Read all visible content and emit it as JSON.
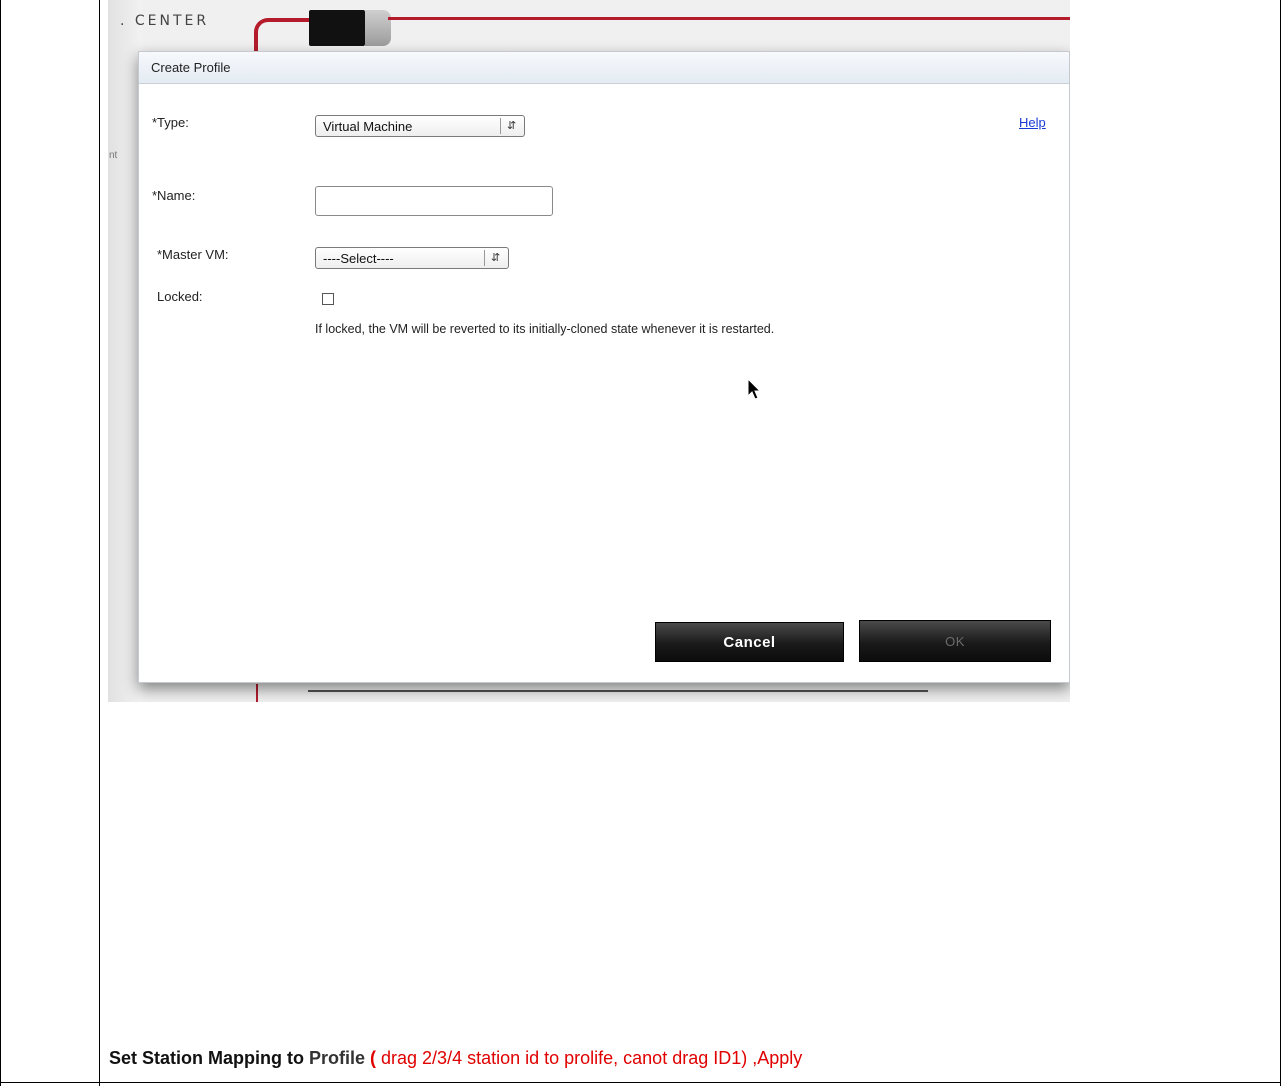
{
  "background": {
    "brand_text": ". CENTER",
    "side_fragment": "nt",
    "accent_color": "#b41c2c"
  },
  "dialog": {
    "title": "Create Profile",
    "help_link": "Help",
    "type": {
      "label": "*Type:",
      "value": "Virtual Machine",
      "arrow_icon": "up-down-arrows-icon"
    },
    "name": {
      "label": "*Name:",
      "value": ""
    },
    "master_vm": {
      "label": "*Master VM:",
      "value": "----Select----"
    },
    "locked": {
      "label": "Locked:",
      "checked": false,
      "hint": "If locked, the VM will be reverted to its initially-cloned state whenever it is restarted."
    },
    "buttons": {
      "cancel": "Cancel",
      "ok": "OK"
    }
  },
  "caption": {
    "part1": "Set Station Mapping to ",
    "part2": "Profile ",
    "part3": "(",
    "part4": " drag 2/3/4 station id to prolife, canot drag ID1) ,Apply"
  }
}
